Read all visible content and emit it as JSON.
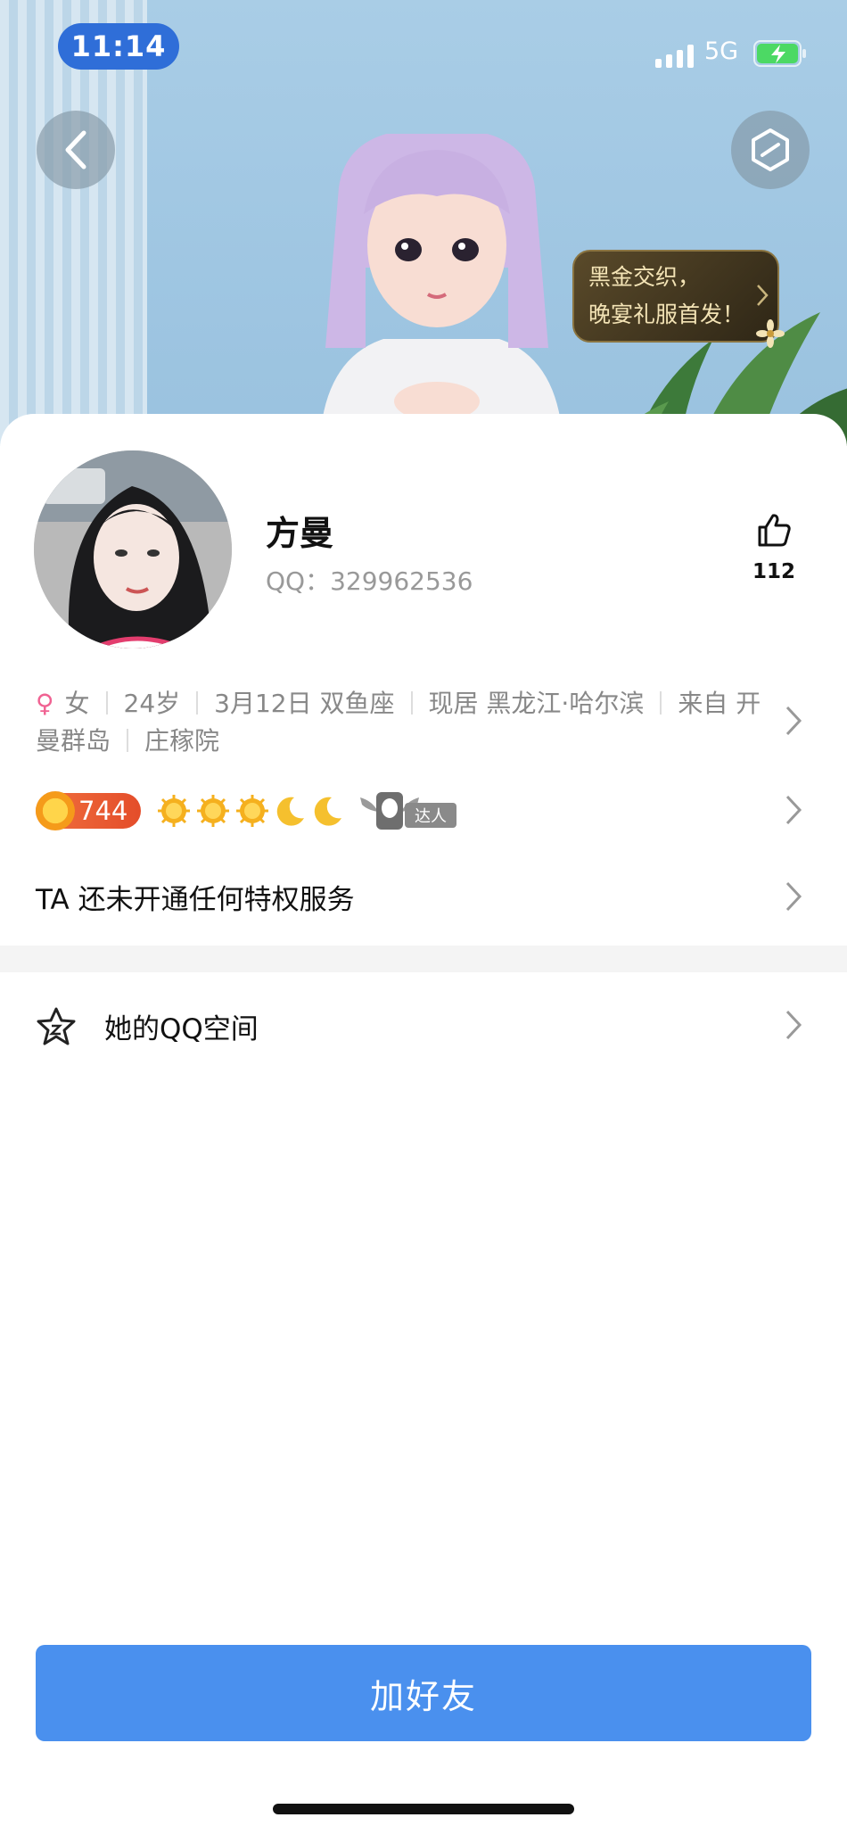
{
  "status_bar": {
    "time": "11:14",
    "network": "5G"
  },
  "promo": {
    "line1": "黑金交织，",
    "line2": "晚宴礼服首发！"
  },
  "profile": {
    "name": "方曼",
    "qq_label": "QQ：",
    "qq_number": "329962536",
    "like_count": "112"
  },
  "info": {
    "gender": "女",
    "age": "24岁",
    "birthday": "3月12日 双鱼座",
    "location": "现居 黑龙江·哈尔滨",
    "hometown": "来自 开曼群岛",
    "school": "庄稼院"
  },
  "level": {
    "value": "744",
    "daren_label": "达人"
  },
  "privilege": {
    "text": "TA 还未开通任何特权服务"
  },
  "qzone": {
    "label": "她的QQ空间"
  },
  "actions": {
    "add_friend": "加好友"
  },
  "colors": {
    "accent": "#4a90ee",
    "time_pill": "#2f6ed8",
    "level_badge": "#e44d2a"
  },
  "icons": {
    "back": "chevron-left-icon",
    "mini_program": "hexagon-icon",
    "like": "thumb-up-icon",
    "gender": "female-icon",
    "qzone": "star-icon",
    "row_more": "chevron-right-icon"
  }
}
